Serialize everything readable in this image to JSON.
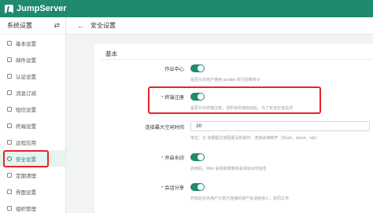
{
  "app": {
    "name": "JumpServer"
  },
  "sidebar": {
    "title": "系统设置",
    "items": [
      {
        "label": "基本设置",
        "icon": "settings-icon"
      },
      {
        "label": "邮件设置",
        "icon": "mail-icon"
      },
      {
        "label": "认证设置",
        "icon": "auth-icon"
      },
      {
        "label": "消息订阅",
        "icon": "message-icon"
      },
      {
        "label": "短信设置",
        "icon": "sms-icon"
      },
      {
        "label": "终端设置",
        "icon": "terminal-icon"
      },
      {
        "label": "远程应用",
        "icon": "remote-app-icon"
      },
      {
        "label": "安全设置",
        "icon": "security-icon",
        "active": true
      },
      {
        "label": "定期清理",
        "icon": "cleanup-icon"
      },
      {
        "label": "界面设置",
        "icon": "interface-icon"
      },
      {
        "label": "组织管理",
        "icon": "org-icon"
      }
    ]
  },
  "header": {
    "title": "安全设置"
  },
  "form": {
    "section_title": "基本",
    "rows": {
      "job_center": {
        "label": "作业中心",
        "help": "是否允许用户使用 ansible 执行批量命令",
        "enabled": true
      },
      "terminal_register": {
        "label": "终端注册",
        "required": true,
        "help": "是否允许终端注册，当所有终端启动后，为了安全应该关闭",
        "enabled": true
      },
      "max_idle_time": {
        "label": "连接最大空闲时间",
        "value": "30",
        "help": "单位：分 如果超过该配置没有操作，连接会被断开（仅ssh，telnet，rdp）"
      },
      "watermark": {
        "label": "开启水印",
        "required": true,
        "help": "启用后，Web 会话和录像将会添加水印信息",
        "enabled": true
      },
      "session_share": {
        "label": "会话分享",
        "required": true,
        "help": "开启后允许用户分享已连接的资产会话给他人，协同工作",
        "enabled": true
      }
    }
  },
  "colors": {
    "brand": "#1f8a70",
    "highlight": "#e8232a"
  }
}
